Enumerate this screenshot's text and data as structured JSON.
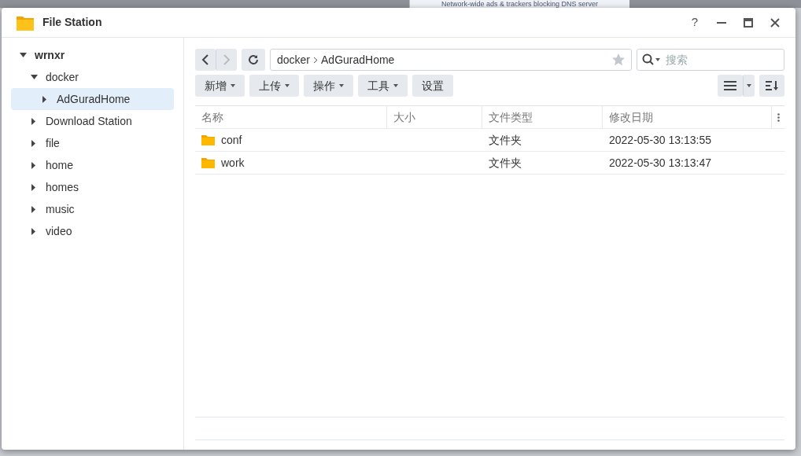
{
  "background_window": {
    "text": "Network-wide ads & trackers blocking DNS server"
  },
  "window": {
    "title": "File Station",
    "controls": [
      "?"
    ]
  },
  "tree": [
    {
      "label": "wrnxr",
      "expanded": true,
      "selected": false,
      "children": [
        {
          "label": "docker",
          "expanded": true,
          "selected": false,
          "children": [
            {
              "label": "AdGuradHome",
              "expanded": false,
              "selected": true
            }
          ]
        },
        {
          "label": "Download Station",
          "expanded": false,
          "selected": false
        },
        {
          "label": "file",
          "expanded": false,
          "selected": false
        },
        {
          "label": "home",
          "expanded": false,
          "selected": false
        },
        {
          "label": "homes",
          "expanded": false,
          "selected": false
        },
        {
          "label": "music",
          "expanded": false,
          "selected": false
        },
        {
          "label": "video",
          "expanded": false,
          "selected": false
        }
      ]
    }
  ],
  "toolbar": {
    "back_disabled": false,
    "forward_disabled": true,
    "path": [
      "docker",
      "AdGuradHome"
    ],
    "favorite": false,
    "search": {
      "placeholder": "搜索"
    },
    "menus": [
      {
        "label": "新增",
        "dropdown": true
      },
      {
        "label": "上传",
        "dropdown": true
      },
      {
        "label": "操作",
        "dropdown": true
      },
      {
        "label": "工具",
        "dropdown": true
      },
      {
        "label": "设置",
        "dropdown": false
      }
    ]
  },
  "table": {
    "columns": [
      "名称",
      "大小",
      "文件类型",
      "修改日期"
    ],
    "rows": [
      {
        "name": "conf",
        "type": "文件夹",
        "modified": "2022-05-30 13:13:55",
        "selected": false
      },
      {
        "name": "work",
        "type": "文件夹",
        "modified": "2022-05-30 13:13:47",
        "selected": false
      }
    ]
  }
}
